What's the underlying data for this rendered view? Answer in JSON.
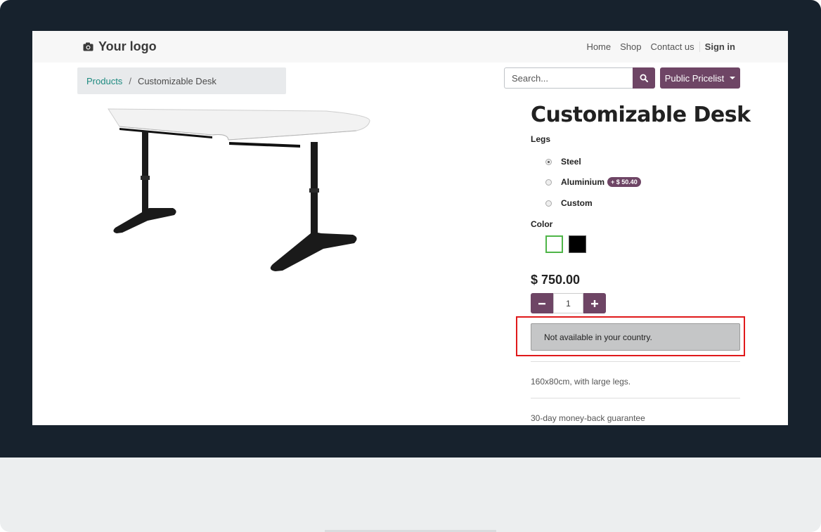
{
  "header": {
    "logo_text": "Your logo",
    "nav": [
      "Home",
      "Shop",
      "Contact us"
    ],
    "signin": "Sign in"
  },
  "breadcrumb": {
    "parent": "Products",
    "separator": "/",
    "current": "Customizable Desk"
  },
  "search": {
    "placeholder": "Search..."
  },
  "pricelist": {
    "label": "Public Pricelist"
  },
  "product": {
    "title": "Customizable Desk",
    "attributes": {
      "legs_label": "Legs",
      "legs_options": [
        {
          "label": "Steel",
          "checked": true
        },
        {
          "label": "Aluminium",
          "extra": "+ $ 50.40",
          "checked": false
        },
        {
          "label": "Custom",
          "checked": false
        }
      ],
      "color_label": "Color",
      "colors": [
        {
          "name": "White",
          "hex": "#ffffff",
          "selected": true
        },
        {
          "name": "Black",
          "hex": "#000000",
          "selected": false
        }
      ]
    },
    "price": "$ 750.00",
    "quantity": "1",
    "availability_message": "Not available in your country.",
    "description": "160x80cm, with large legs.",
    "guarantee": "30-day money-back guarantee"
  },
  "colors": {
    "brand": "#6e4565",
    "highlight": "#e0191b",
    "link": "#1e8a80"
  }
}
